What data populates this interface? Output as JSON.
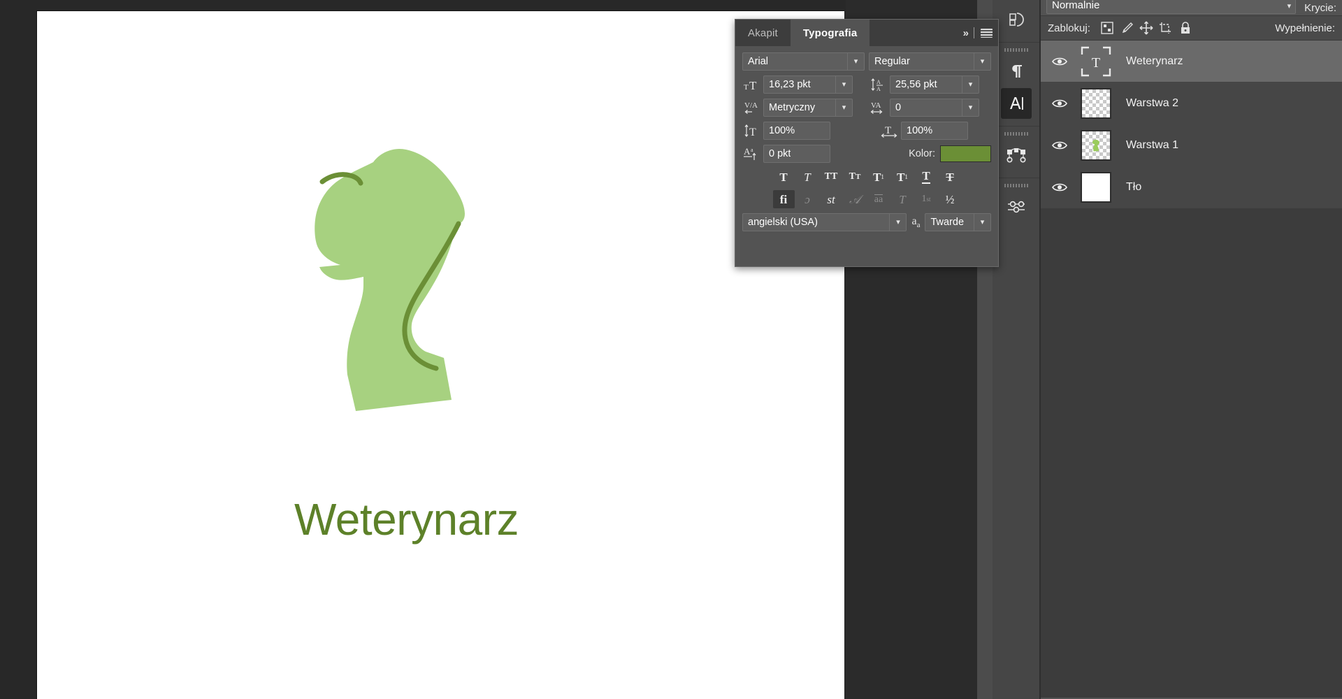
{
  "app": {
    "canvas": {
      "artwork_name": "vet-dog-logo",
      "wordmark": "Weterynarz",
      "logo_fill": "#a7d180",
      "logo_outline": "#6b8f36",
      "wordmark_color": "#5d8129",
      "sheet_background": "#ffffff"
    }
  },
  "icon_rail": {
    "groups": [
      {
        "items": [
          {
            "icon": "path-operations-icon",
            "active": false
          }
        ]
      },
      {
        "items": [
          {
            "icon": "paragraph-pilcrow-icon",
            "active": false
          },
          {
            "icon": "character-type-icon",
            "active": true
          }
        ]
      },
      {
        "items": [
          {
            "icon": "bezier-path-icon",
            "active": false
          }
        ]
      },
      {
        "items": [
          {
            "icon": "sliders-adjustments-icon",
            "active": false
          }
        ]
      }
    ]
  },
  "typography_panel": {
    "tabs": [
      {
        "label": "Akapit",
        "active": false
      },
      {
        "label": "Typografia",
        "active": true
      }
    ],
    "collapse_icon": "»",
    "menu_icon": "panel-menu-icon",
    "font_family": {
      "label": "font-family-field",
      "value": "Arial"
    },
    "font_style": {
      "label": "font-style-field",
      "value": "Regular"
    },
    "font_size": {
      "icon": "font-size-icon",
      "value": "16,23 pkt"
    },
    "leading": {
      "icon": "leading-icon",
      "value": "25,56 pkt"
    },
    "kerning": {
      "icon": "kerning-icon",
      "value": "Metryczny"
    },
    "tracking": {
      "icon": "tracking-icon",
      "value": "0"
    },
    "vertical_scale": {
      "icon": "vertical-scale-icon",
      "value": "100%"
    },
    "horizontal_scale": {
      "icon": "horizontal-scale-icon",
      "value": "100%"
    },
    "baseline_shift": {
      "icon": "baseline-shift-icon",
      "value": "0 pkt"
    },
    "color": {
      "label": "Kolor:",
      "value": "#6b8f36"
    },
    "style_row_1": [
      {
        "name": "faux-bold-button",
        "glyph": "T",
        "state": "bold",
        "on": false
      },
      {
        "name": "faux-italic-button",
        "glyph": "T",
        "state": "italic",
        "on": false
      },
      {
        "name": "all-caps-button",
        "glyph": "TT",
        "state": "normal",
        "on": false
      },
      {
        "name": "small-caps-button",
        "glyph": "Tт",
        "state": "normal",
        "on": false
      },
      {
        "name": "superscript-button",
        "glyph": "T",
        "state": "sup",
        "on": false
      },
      {
        "name": "subscript-button",
        "glyph": "T",
        "state": "sub",
        "on": false
      },
      {
        "name": "underline-button",
        "glyph": "T",
        "state": "underline",
        "on": false
      },
      {
        "name": "strikethrough-button",
        "glyph": "T",
        "state": "strike",
        "on": false
      }
    ],
    "style_row_2": [
      {
        "name": "standard-ligatures-button",
        "glyph": "fi",
        "on": true,
        "dim": false
      },
      {
        "name": "contextual-alternates-button",
        "glyph": "ɔ̵",
        "on": false,
        "dim": true
      },
      {
        "name": "discretionary-ligatures-button",
        "glyph": "st",
        "on": false,
        "dim": false
      },
      {
        "name": "swash-button",
        "glyph": "ᴬ",
        "on": false,
        "dim": true
      },
      {
        "name": "old-style-button",
        "glyph": "aa",
        "on": false,
        "dim": true
      },
      {
        "name": "titling-alternates-button",
        "glyph": "T",
        "on": false,
        "dim": true
      },
      {
        "name": "ordinals-button",
        "glyph": "1st",
        "on": false,
        "dim": true
      },
      {
        "name": "fractions-button",
        "glyph": "½",
        "on": false,
        "dim": false
      }
    ],
    "language": {
      "value": "angielski (USA)"
    },
    "antialias_icon": "aa-antialias-icon",
    "antialias_method": {
      "value": "Twarde"
    }
  },
  "layers_panel": {
    "blend_mode": {
      "value": "Normalnie"
    },
    "opacity_label": "Krycie:",
    "lock_label": "Zablokuj:",
    "lock_icons": [
      "lock-transparent-pixels-icon",
      "lock-image-pixels-icon",
      "lock-position-icon",
      "lock-artboard-nesting-icon",
      "lock-all-icon"
    ],
    "fill_label": "Wypełnienie:",
    "layers": [
      {
        "name": "Weterynarz",
        "thumb": "text",
        "visible": true,
        "selected": true
      },
      {
        "name": "Warstwa 2",
        "thumb": "empty-transparent",
        "visible": true,
        "selected": false
      },
      {
        "name": "Warstwa 1",
        "thumb": "transparent-with-logo",
        "visible": true,
        "selected": false
      },
      {
        "name": "Tło",
        "thumb": "white",
        "visible": true,
        "selected": false
      }
    ]
  },
  "scrollbar": {
    "name": "canvas-vertical-scrollbar"
  }
}
